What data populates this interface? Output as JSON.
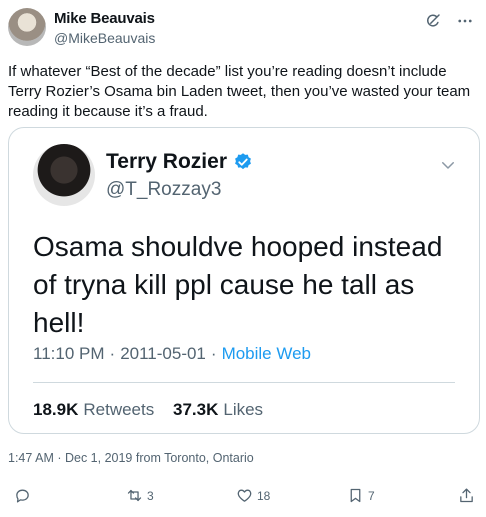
{
  "tweet": {
    "author": {
      "name": "Mike Beauvais",
      "handle": "@MikeBeauvais"
    },
    "text": "If whatever “Best of the decade” list you’re reading doesn’t include Terry Rozier’s Osama bin Laden tweet, then you’ve wasted your team reading it because it’s a fraud.",
    "quoted": {
      "name": "Terry Rozier",
      "handle": "@T_Rozzay3",
      "text": "Osama shouldve hooped instead of tryna kill ppl cause he tall as hell!",
      "time": "11:10 PM",
      "date": "2011-05-01",
      "sep1": "·",
      "sep2": "·",
      "source": "Mobile Web",
      "retweets_count": "18.9K",
      "retweets_label": "Retweets",
      "likes_count": "37.3K",
      "likes_label": "Likes"
    },
    "timestamp": "1:47 AM · Dec 1, 2019 from Toronto, Ontario",
    "actions": {
      "reply": "",
      "retweets": "3",
      "likes": "18",
      "bookmarks": "7"
    }
  },
  "colors": {
    "accent": "#1d9bf0",
    "secondary_text": "#536471",
    "border": "#cfd9de"
  },
  "icons": [
    "grok-icon",
    "more-icon",
    "verified-icon",
    "chevron-down-icon",
    "reply-icon",
    "retweet-icon",
    "like-icon",
    "bookmark-icon",
    "share-icon"
  ]
}
